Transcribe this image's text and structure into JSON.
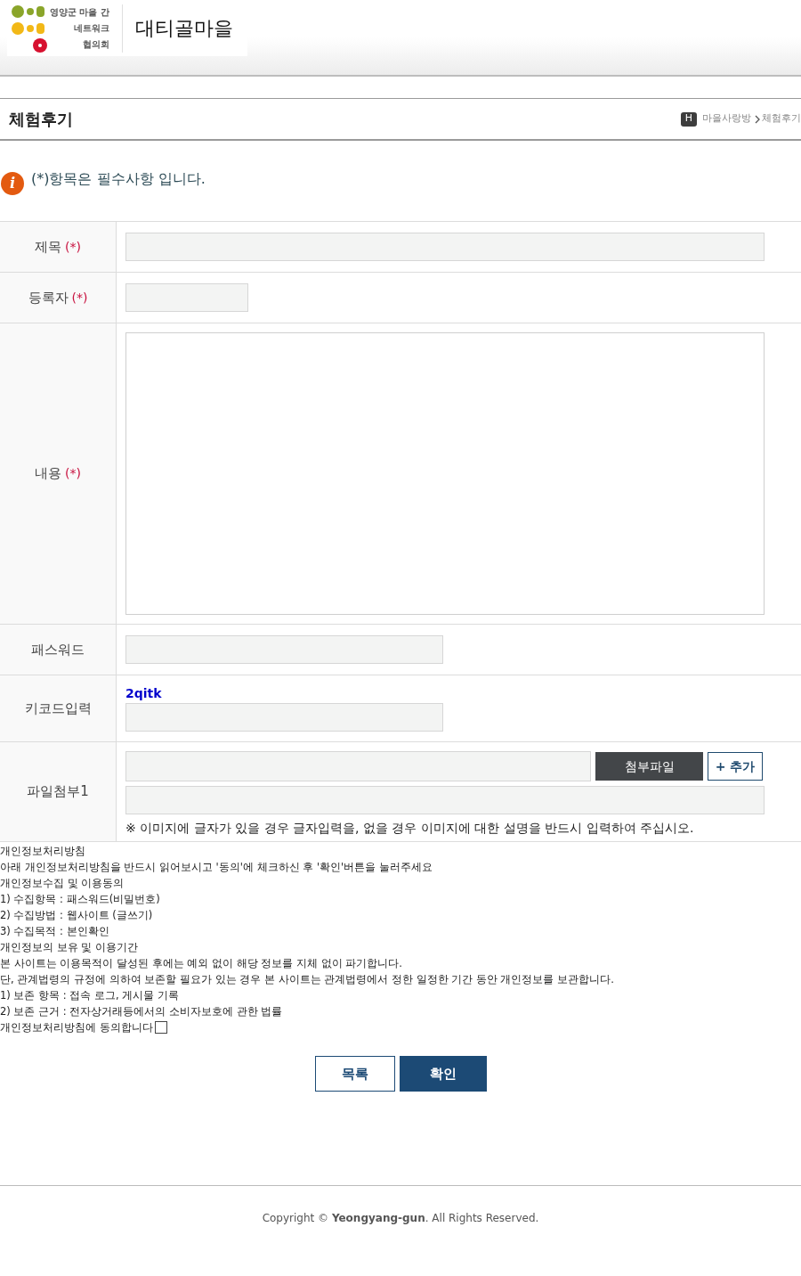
{
  "header": {
    "logo_lines": [
      "영양군 마을 간",
      "네트워크",
      "협의회"
    ],
    "site_name": "대티골마을"
  },
  "page_title": "체험후기",
  "breadcrumb": {
    "home": "H",
    "items": [
      "마을사랑방",
      "체험후기"
    ]
  },
  "notice": {
    "icon": "i",
    "text": "(*)항목은 필수사항 입니다."
  },
  "form_rows": [
    {
      "kind": "wide",
      "label": "제목",
      "required_mark": "(*)"
    },
    {
      "kind": "short",
      "label": "등록자",
      "required_mark": "(*)"
    },
    {
      "kind": "textarea",
      "label": "내용",
      "required_mark": "(*)"
    },
    {
      "kind": "medium",
      "label": "패스워드"
    },
    {
      "kind": "captcha",
      "label": "키코드입력",
      "captcha": "2qitk"
    },
    {
      "kind": "file",
      "label": "파일첨부1",
      "file_button": "첨부파일",
      "add_button": "+ 추가",
      "note": "※ 이미지에 글자가 있을 경우 글자입력을, 없을 경우 이미지에 대한 설명을 반드시 입력하여 주십시오."
    }
  ],
  "privacy": {
    "lines": [
      "개인정보처리방침",
      "아래 개인정보처리방침을 반드시 읽어보시고 '동의'에 체크하신 후 '확인'버튼을 눌러주세요",
      "개인정보수집 및 이용동의",
      "1) 수집항목 : 패스워드(비밀번호)",
      "2) 수집방법 : 웹사이트 (글쓰기)",
      "3) 수집목적 : 본인확인",
      "개인정보의 보유 및 이용기간",
      "본 사이트는 이용목적이 달성된 후에는 예외 없이 해당 정보를 지체 없이 파기합니다.",
      "단, 관계법령의 규정에 의하여 보존할 필요가 있는 경우 본 사이트는 관계법령에서 정한 일정한 기간 동안 개인정보를 보관합니다.",
      "1) 보존 항목 : 접속 로그, 게시물 기록",
      "2) 보존 근거 : 전자상거래등에서의 소비자보호에 관한 법률"
    ],
    "agree_label": "개인정보처리방침에 동의합니다",
    "agree_checked": false
  },
  "buttons": [
    {
      "kind": "secondary",
      "label": "목록"
    },
    {
      "kind": "primary",
      "label": "확인"
    }
  ],
  "footer": "Copyright © **Yeongyang-gun**. All Rights Reserved."
}
